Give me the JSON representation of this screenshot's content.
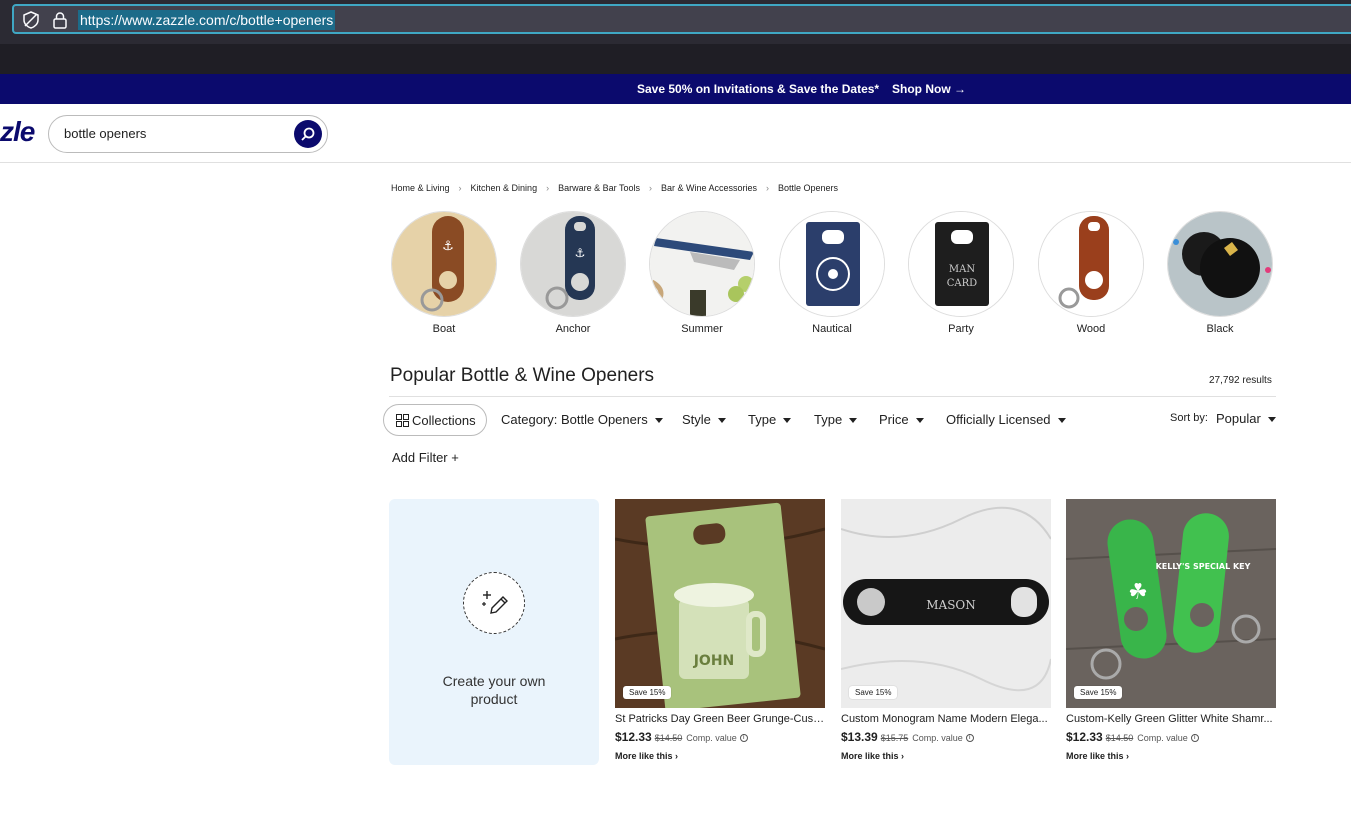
{
  "browser": {
    "url": "https://www.zazzle.com/c/bottle+openers"
  },
  "promo": {
    "message": "Save 50% on Invitations & Save the Dates*",
    "cta": "Shop Now →"
  },
  "header": {
    "logo_text": "zle",
    "search_value": "bottle openers"
  },
  "breadcrumbs": [
    "Home & Living",
    "Kitchen & Dining",
    "Barware & Bar Tools",
    "Bar & Wine Accessories",
    "Bottle Openers"
  ],
  "categories": [
    {
      "label": "Boat"
    },
    {
      "label": "Anchor"
    },
    {
      "label": "Summer"
    },
    {
      "label": "Nautical"
    },
    {
      "label": "Party"
    },
    {
      "label": "Wood"
    },
    {
      "label": "Black"
    }
  ],
  "category_art": {
    "party_card_line1": "MAN",
    "party_card_line2": "CARD"
  },
  "listing": {
    "title": "Popular Bottle & Wine Openers",
    "results": "27,792 results"
  },
  "filters": {
    "collections": "Collections",
    "items": [
      "Category: Bottle Openers",
      "Style",
      "Type",
      "Type",
      "Price",
      "Officially Licensed"
    ],
    "sort_label": "Sort by:",
    "sort_value": "Popular",
    "add_filter": "Add Filter  +"
  },
  "create_card": {
    "line1": "Create your own",
    "line2": "product"
  },
  "products": [
    {
      "badge": "Save 15%",
      "name": "St Patricks Day Green Beer Grunge-Cust...",
      "price": "$12.33",
      "old_price": "$14.50",
      "comp": "Comp. value",
      "more": "More like this",
      "art_text": "JOHN"
    },
    {
      "badge": "Save 15%",
      "name": "Custom Monogram Name Modern Elega...",
      "price": "$13.39",
      "old_price": "$15.75",
      "comp": "Comp. value",
      "more": "More like this",
      "art_text": "MASON"
    },
    {
      "badge": "Save 15%",
      "name": "Custom-Kelly Green Glitter White Shamr...",
      "price": "$12.33",
      "old_price": "$14.50",
      "comp": "Comp. value",
      "more": "More like this",
      "art_text": "KELLY'S SPECIAL KEY"
    }
  ],
  "colors": {
    "brand_navy": "#0b0a6d",
    "chrome_bg": "#2b2a33",
    "create_bg": "#eaf4fc"
  }
}
